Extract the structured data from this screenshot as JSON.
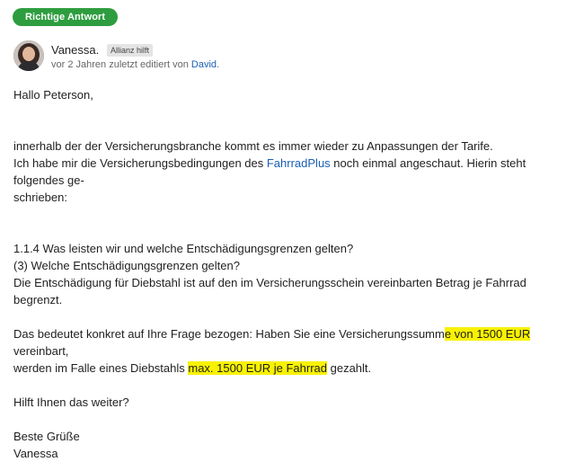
{
  "badge": {
    "label": "Richtige Antwort"
  },
  "author": {
    "name": "Vanessa.",
    "role": "Allianz hilft",
    "meta_prefix": "vor 2 Jahren zuletzt editiert von",
    "editor": "David",
    "meta_suffix": "."
  },
  "colors": {
    "badge": "#2e9d3f",
    "link": "#1a5fb4",
    "highlight": "#f8f200"
  },
  "post": {
    "greeting": "Hallo Peterson,",
    "p1_line1": "innerhalb der der Versicherungsbranche kommt es immer wieder zu Anpassungen der Tarife.",
    "p1_line2_a": "Ich habe mir die Versicherungsbedingungen des ",
    "p1_link": "FahrradPlus",
    "p1_line2_b": " noch einmal angeschaut. Hierin steht folgendes ge-",
    "p1_line3": "schrieben:",
    "q1": "1.1.4 Was leisten wir und welche Entschädigungsgrenzen gelten?",
    "q2": "(3) Welche Entschädigungsgrenzen gelten?",
    "q3": "Die Entschädigung für Diebstahl ist auf den im Versicherungsschein vereinbarten Betrag je Fahrrad begrenzt.",
    "c1_a": "Das bedeutet konkret auf Ihre Frage bezogen: Haben Sie eine Versicherungssumm",
    "c1_hl": "e von 1500 EUR",
    "c1_b": " vereinbart,",
    "c2_a": "werden im Falle eines Diebstahls ",
    "c2_hl": "max. 1500 EUR je Fahrrad",
    "c2_b": " gezahlt.",
    "question": "Hilft Ihnen das weiter?",
    "closing": "Beste Grüße",
    "signature": "Vanessa"
  }
}
